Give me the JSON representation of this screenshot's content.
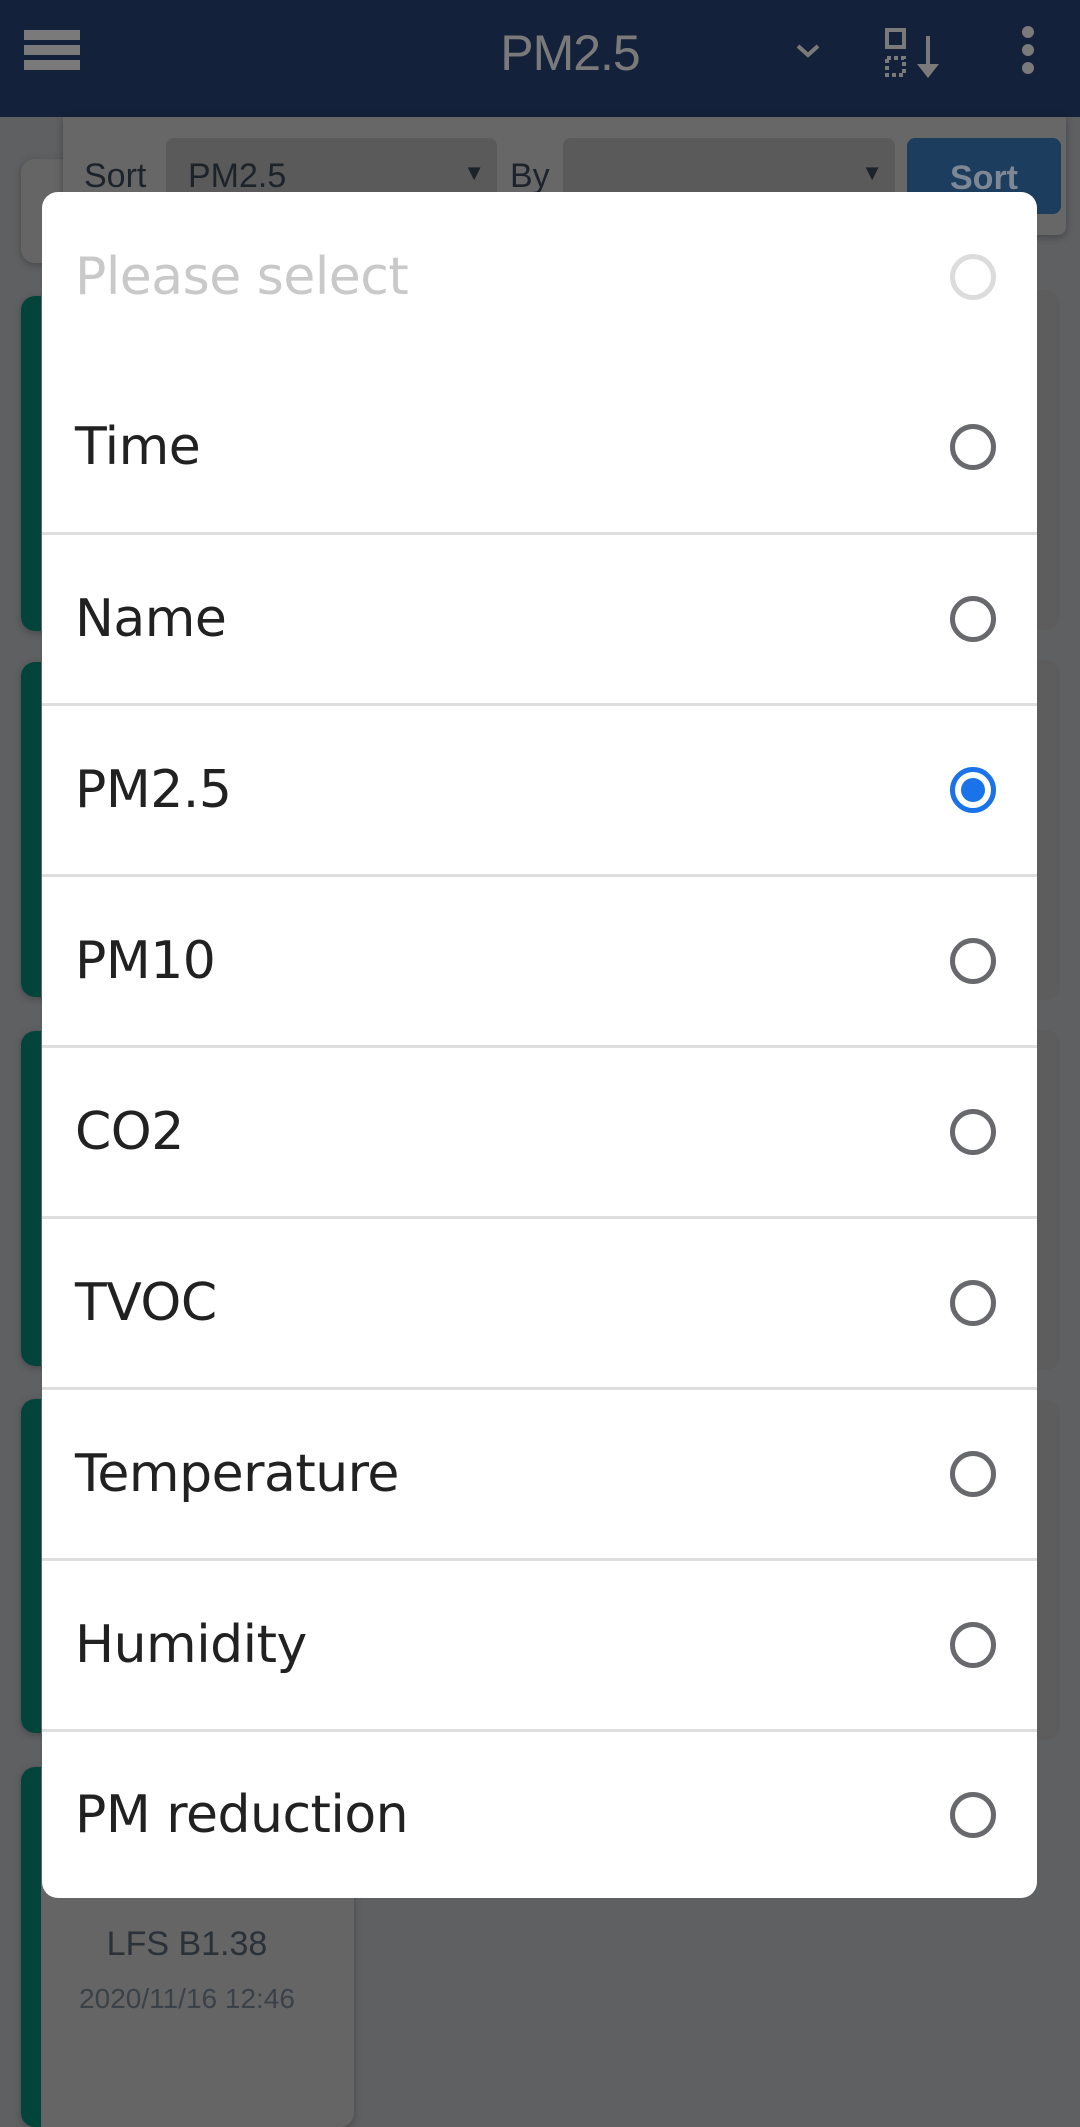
{
  "header": {
    "title": "PM2.5",
    "menu_icon": "hamburger-menu-icon",
    "dropdown_icon": "chevron-down-icon",
    "sort_icon": "sort-descending-icon",
    "more_icon": "more-vertical-icon"
  },
  "sort_panel": {
    "sort_label": "Sort",
    "sort_field_value": "PM2.5",
    "by_label": "By",
    "by_field_value": "",
    "dropdown_arrow": "▼",
    "sort_button": "Sort"
  },
  "background_card": {
    "name": "LFS B1.38",
    "timestamp": "2020/11/16 12:46"
  },
  "dialog": {
    "placeholder": "Please select",
    "options": [
      {
        "label": "Time",
        "selected": false
      },
      {
        "label": "Name",
        "selected": false
      },
      {
        "label": "PM2.5",
        "selected": true
      },
      {
        "label": "PM10",
        "selected": false
      },
      {
        "label": "CO2",
        "selected": false
      },
      {
        "label": "TVOC",
        "selected": false
      },
      {
        "label": "Temperature",
        "selected": false
      },
      {
        "label": "Humidity",
        "selected": false
      },
      {
        "label": "PM reduction",
        "selected": false
      }
    ]
  },
  "colors": {
    "header_bg": "#14213a",
    "accent_radio": "#1a73e8",
    "card_strip": "#02443a",
    "sort_button_bg": "#1c3d5e"
  }
}
